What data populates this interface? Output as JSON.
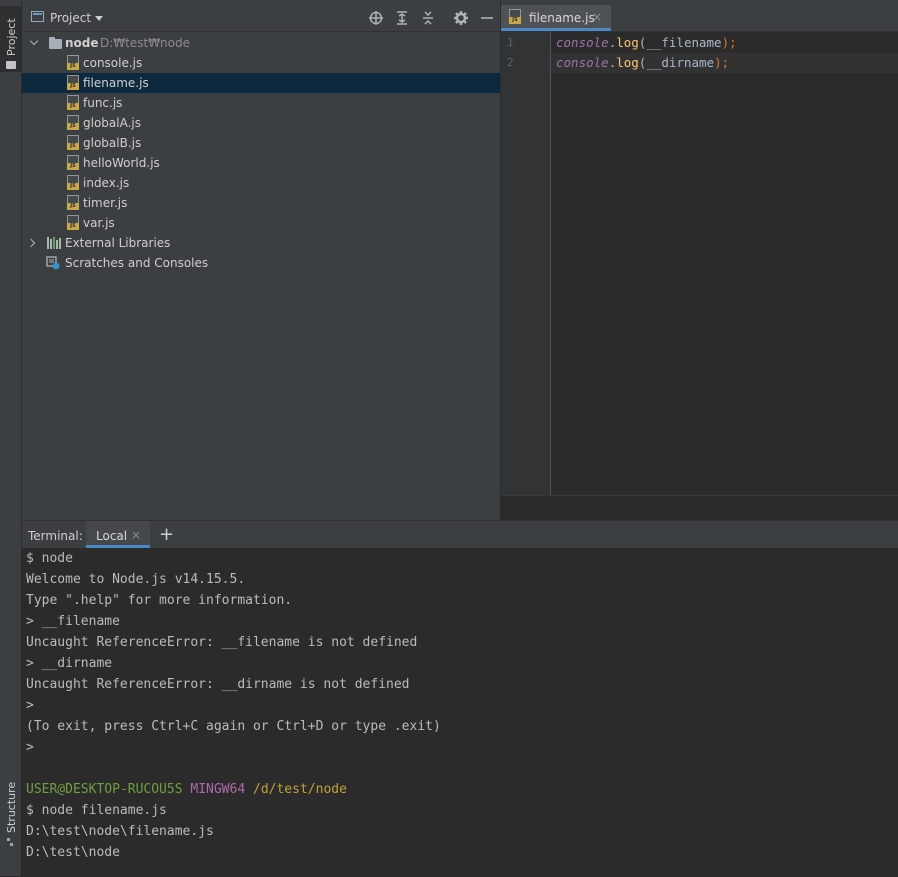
{
  "sidebar_left": {
    "project_tab": "Project",
    "structure_tab": "Structure"
  },
  "project": {
    "title": "Project",
    "root": {
      "name": "node",
      "path": "D:₩test₩node"
    },
    "files": [
      "console.js",
      "filename.js",
      "func.js",
      "globalA.js",
      "globalB.js",
      "helloWorld.js",
      "index.js",
      "timer.js",
      "var.js"
    ],
    "selected_file": "filename.js",
    "external_libraries": "External Libraries",
    "scratches": "Scratches and Consoles",
    "file_badge": "JS"
  },
  "editor": {
    "tab": {
      "label": "filename.js",
      "close": "×"
    },
    "lines": [
      {
        "num": "1",
        "obj": "console",
        "method": "log",
        "arg": "__filename"
      },
      {
        "num": "2",
        "obj": "console",
        "method": "log",
        "arg": "__dirname"
      }
    ],
    "dot": ".",
    "paren_open": "(",
    "paren_close_semi": ");"
  },
  "terminal": {
    "label": "Terminal:",
    "tab": {
      "label": "Local",
      "close": "×"
    },
    "add": "+",
    "lines": [
      "$ node",
      "Welcome to Node.js v14.15.5.",
      "Type \".help\" for more information.",
      "> __filename",
      "Uncaught ReferenceError: __filename is not defined",
      "> __dirname",
      "Uncaught ReferenceError: __dirname is not defined",
      ">",
      "(To exit, press Ctrl+C again or Ctrl+D or type .exit)",
      ">"
    ],
    "prompt": {
      "user": "USER@DESKTOP-RUCOU5S",
      "shell": "MINGW64",
      "path": "/d/test/node"
    },
    "after_lines": [
      "$ node filename.js",
      "D:\\test\\node\\filename.js",
      "D:\\test\\node"
    ]
  },
  "colors": {
    "accent": "#4a88c7",
    "selection": "#0d293e",
    "js_badge": "#c8a94a"
  }
}
